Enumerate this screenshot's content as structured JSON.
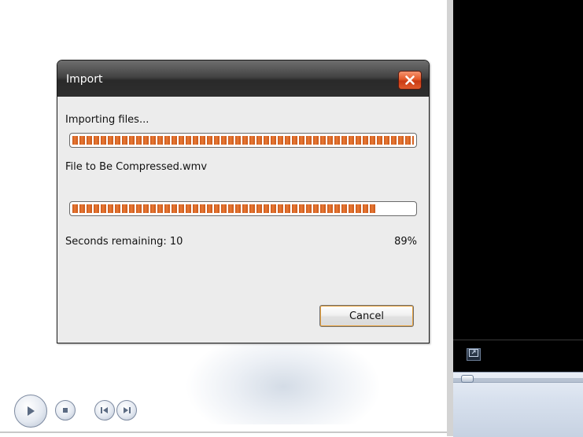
{
  "dialog": {
    "title": "Import",
    "close_icon": "close-icon",
    "status_label": "Importing files...",
    "overall_progress": 1.0,
    "file_label": "File to Be Compressed.wmv",
    "file_progress": 0.89,
    "remaining_label": "Seconds remaining: 10",
    "percent_label": "89%",
    "cancel_label": "Cancel"
  },
  "player": {
    "fullscreen_icon": "fullscreen-icon",
    "play_icon": "play-icon",
    "stop_icon": "stop-icon",
    "previous_icon": "previous-icon",
    "next_icon": "next-icon"
  },
  "colors": {
    "progress_fill": "#e06a26",
    "titlebar": "#3a3a3a",
    "close_button": "#e05a2c"
  }
}
